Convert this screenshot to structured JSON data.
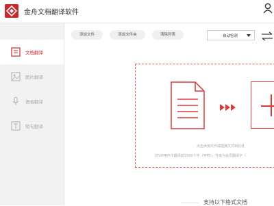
{
  "app": {
    "title": "金舟文档翻译软件"
  },
  "sidebar": {
    "items": [
      {
        "label": "文档翻译",
        "icon": "document-icon",
        "active": true
      },
      {
        "label": "图片翻译",
        "icon": "image-icon",
        "active": false
      },
      {
        "label": "语音翻译",
        "icon": "microphone-icon",
        "active": false
      },
      {
        "label": "短句翻译",
        "icon": "text-icon",
        "active": false
      }
    ]
  },
  "toolbar": {
    "add_file": "添加文件",
    "add_folder": "添加文件夹",
    "clear_list": "清除列表",
    "language_select": "自动检测"
  },
  "dropzone": {
    "hint_primary": "点击添加文件或拖拽文件到此处",
    "hint_secondary": "非VIP用户仅翻译前1500个字（字符），升级为会员翻译字（"
  },
  "footer": {
    "formats_label": "支持以下格式文档"
  },
  "colors": {
    "accent": "#c9282d"
  }
}
